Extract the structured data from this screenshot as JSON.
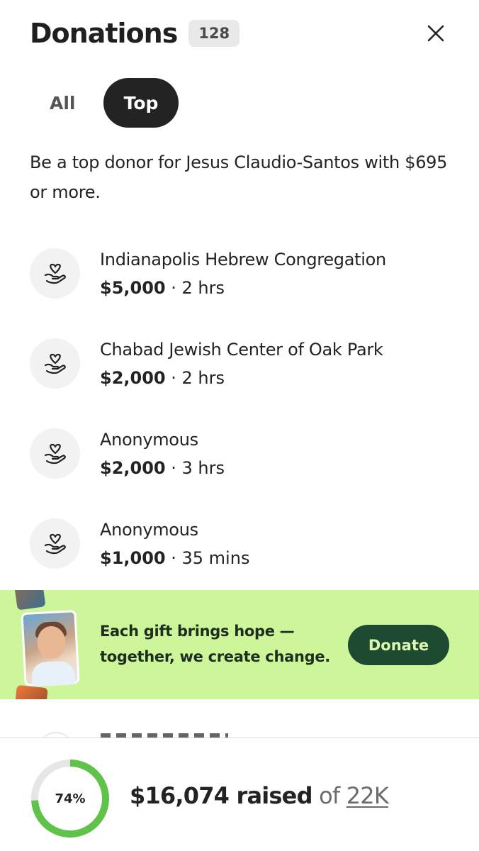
{
  "header": {
    "title": "Donations",
    "count": "128"
  },
  "tabs": [
    {
      "label": "All",
      "active": false
    },
    {
      "label": "Top",
      "active": true
    }
  ],
  "subtitle": "Be a top donor for Jesus Claudio-Santos with $695 or more.",
  "donors": [
    {
      "name": "Indianapolis Hebrew Congregation",
      "amount": "$5,000",
      "time": " · 2 hrs",
      "icon": "heart-hand-icon"
    },
    {
      "name": "Chabad Jewish Center of Oak Park",
      "amount": "$2,000",
      "time": " · 2 hrs",
      "icon": "heart-hand-icon"
    },
    {
      "name": "Anonymous",
      "amount": "$2,000",
      "time": " · 3 hrs",
      "icon": "heart-hand-icon"
    },
    {
      "name": "Anonymous",
      "amount": "$1,000",
      "time": " · 35 mins",
      "icon": "heart-hand-icon"
    }
  ],
  "banner": {
    "line1": "Each gift brings hope —",
    "line2": "together, we create change.",
    "button_label": "Donate",
    "background_color": "#cdf59a",
    "button_color": "#1f4a32"
  },
  "footer": {
    "progress_label": "74%",
    "progress_fraction": 0.74,
    "raised_amount": "$16,074 raised",
    "of_text": " of ",
    "goal": "22K",
    "ring_color": "#5fc34a"
  }
}
